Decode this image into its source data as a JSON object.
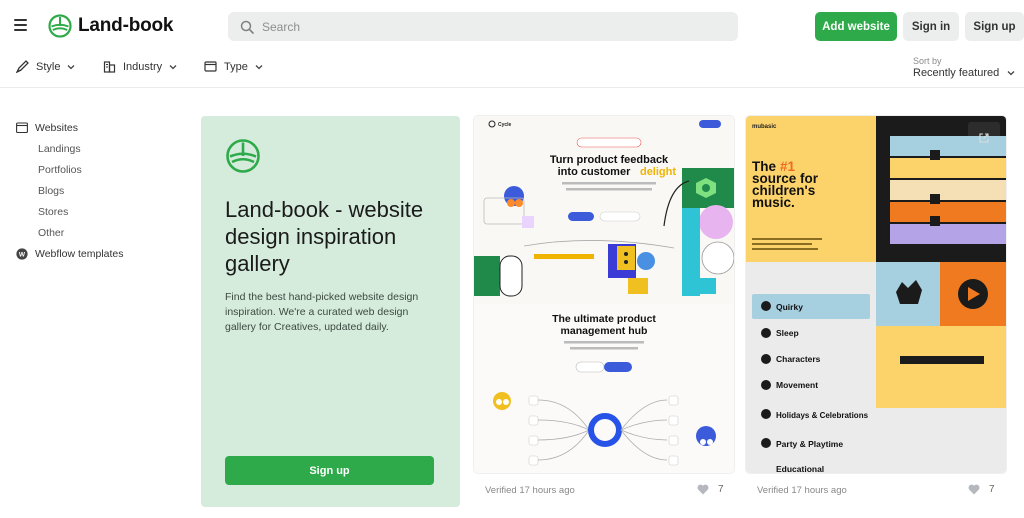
{
  "header": {
    "logo_text": "Land-book",
    "search_placeholder": "Search",
    "add_website": "Add website",
    "sign_in": "Sign in",
    "sign_up": "Sign up"
  },
  "filters": {
    "style": "Style",
    "industry": "Industry",
    "type": "Type",
    "sort_label": "Sort by",
    "sort_value": "Recently featured"
  },
  "sidebar": {
    "websites": "Websites",
    "items": [
      "Landings",
      "Portfolios",
      "Blogs",
      "Stores",
      "Other"
    ],
    "webflow": "Webflow templates"
  },
  "hero": {
    "title": "Land-book - website design inspiration gallery",
    "description": "Find the best hand-picked website design inspiration. We're a curated web design gallery for Creatives, updated daily.",
    "button": "Sign up"
  },
  "cards": [
    {
      "brand": "Cycle",
      "headline_1": "Turn product feedback",
      "headline_2": "into customer",
      "headline_accent": "delight",
      "section_title_1": "The ultimate product",
      "section_title_2": "management hub",
      "verified": "Verified 17 hours ago",
      "likes": "7"
    },
    {
      "brand": "mubasic",
      "headline_pre": "The",
      "headline_accent": "#1",
      "headline_rest_1": "source for",
      "headline_rest_2": "children's",
      "headline_rest_3": "music.",
      "genres": [
        "Quirky",
        "Sleep",
        "Characters",
        "Movement",
        "Holidays & Celebrations",
        "Party & Playtime",
        "Educational"
      ],
      "verified": "Verified 17 hours ago",
      "likes": "7"
    }
  ],
  "colors": {
    "accent": "#2faa4a",
    "hero_bg": "#d5ecdc",
    "search_bg": "#eceeed"
  }
}
